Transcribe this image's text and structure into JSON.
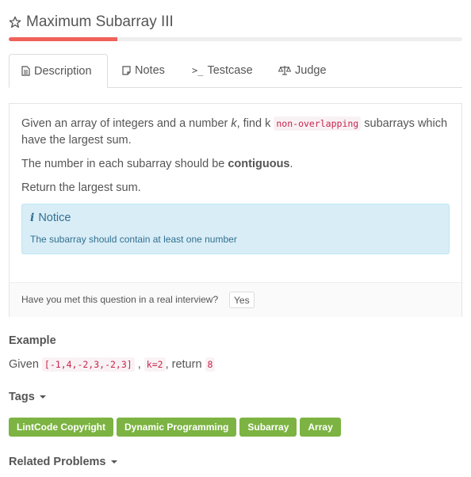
{
  "problem": {
    "title": "Maximum Subarray III",
    "progress_fraction": 0.24,
    "progress_color": "#f0625a",
    "tag_color": "#7cb342"
  },
  "tabs": [
    {
      "label": "Description",
      "icon": "file-text-icon"
    },
    {
      "label": "Notes",
      "icon": "note-icon"
    },
    {
      "label": "Testcase",
      "icon": "terminal-icon"
    },
    {
      "label": "Judge",
      "icon": "balance-scale-icon"
    }
  ],
  "description": {
    "p1_a": "Given an array of integers and a number ",
    "p1_k": "k",
    "p1_b": ", find k ",
    "p1_code": "non-overlapping",
    "p1_c": " subarrays which have the largest sum.",
    "p2_a": "The number in each subarray should be ",
    "p2_bold": "contiguous",
    "p2_b": ".",
    "p3": "Return the largest sum."
  },
  "notice": {
    "title": "Notice",
    "text": "The subarray should contain at least one number"
  },
  "footer": {
    "question": "Have you met this question in a real interview?",
    "yes_label": "Yes"
  },
  "example": {
    "heading": "Example",
    "given": "Given ",
    "array": "[-1,4,-2,3,-2,3]",
    "sep": " , ",
    "k": "k=2",
    "ret": ", return ",
    "result": "8"
  },
  "tags": {
    "heading": "Tags",
    "items": [
      "LintCode Copyright",
      "Dynamic Programming",
      "Subarray",
      "Array"
    ]
  },
  "related": {
    "heading": "Related Problems"
  }
}
